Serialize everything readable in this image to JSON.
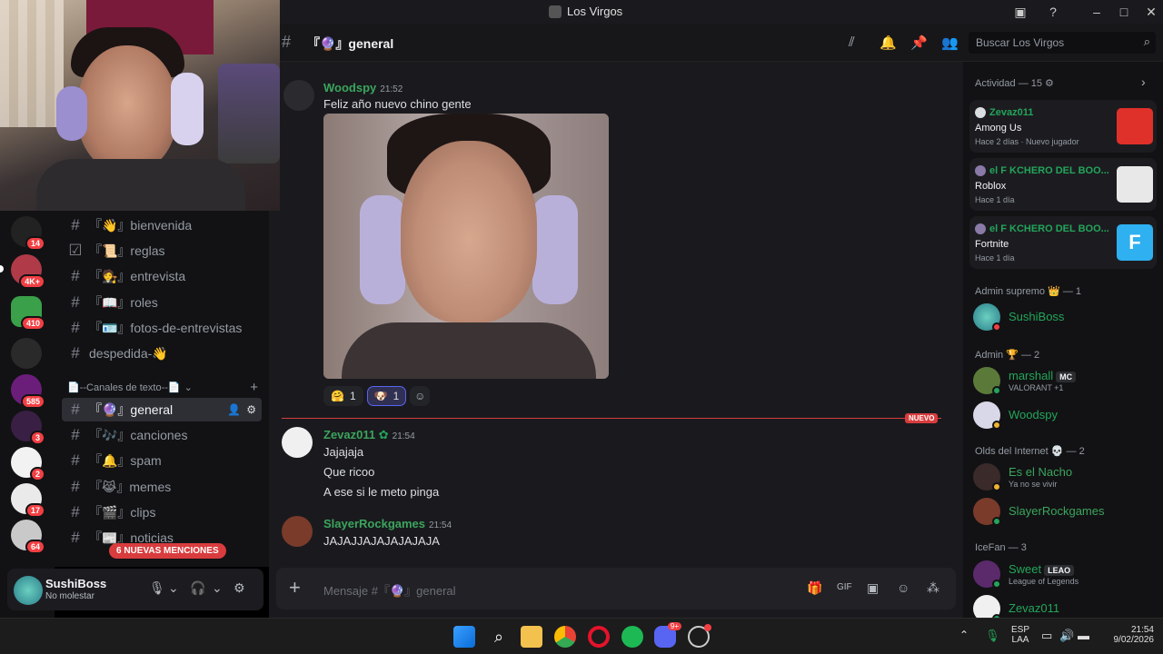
{
  "window": {
    "title": "Los Virgos"
  },
  "server_badges": [
    "14",
    "4K+",
    "410",
    "585",
    "3",
    "2",
    "17",
    "64"
  ],
  "channels": {
    "top": [
      {
        "label": "『👋』bienvenida"
      },
      {
        "label": "『📜』reglas"
      },
      {
        "label": "『🧑‍⚖️』entrevista"
      },
      {
        "label": "『📖』roles"
      },
      {
        "label": "『🪪』fotos-de-entrevistas"
      },
      {
        "label": "despedida-👋"
      }
    ],
    "category": "📄--Canales de texto--📄",
    "list": [
      {
        "label": "『🔮』general"
      },
      {
        "label": "『🎶』canciones"
      },
      {
        "label": "『🔔』spam"
      },
      {
        "label": "『😹』memes"
      },
      {
        "label": "『🎬』clips"
      },
      {
        "label": "『📰』noticias"
      }
    ],
    "mentions_pill": "6 NUEVAS MENCIONES"
  },
  "user": {
    "name": "SushiBoss",
    "status": "No molestar"
  },
  "chat": {
    "channel_name": "『🔮』general",
    "search_placeholder": "Buscar Los Virgos",
    "composer_placeholder": "Mensaje #『🔮』general",
    "new_label": "NUEVO",
    "messages": [
      {
        "author": "Woodspy",
        "time": "21:52",
        "lines": [
          "Feliz año nuevo chino gente"
        ],
        "color": "#3ba55d"
      },
      {
        "author": "Zevaz011",
        "time": "21:54",
        "lines": [
          "Jajajaja",
          "Que ricoo",
          "A ese si le meto pinga"
        ],
        "color": "#3ba55d"
      },
      {
        "author": "SlayerRockgames",
        "time": "21:54",
        "lines": [
          "JAJAJJAJAJAJAJAJA"
        ],
        "color": "#3ba55d"
      }
    ],
    "reactions": [
      {
        "emoji": "🤗",
        "count": "1"
      },
      {
        "emoji": "🐶",
        "count": "1"
      }
    ]
  },
  "activity": {
    "title": "Actividad — 15",
    "cards": [
      {
        "who": "Zevaz011",
        "game": "Among Us",
        "meta": "Hace 2 días · Nuevo jugador"
      },
      {
        "who": "el F KCHERO DEL BOO...",
        "game": "Roblox",
        "meta": "Hace 1 día"
      },
      {
        "who": "el F KCHERO DEL BOO...",
        "game": "Fortnite",
        "meta": "Hace 1 día"
      }
    ]
  },
  "members": {
    "groups": [
      {
        "title": "Admin supremo 👑 — 1"
      },
      {
        "title": "Admin 🏆 — 2"
      },
      {
        "title": "Olds del Internet 💀 — 2"
      },
      {
        "title": "IceFan — 3"
      }
    ],
    "people": [
      {
        "name": "SushiBoss",
        "sub": ""
      },
      {
        "name": "marshall",
        "tag": "MC",
        "sub": "VALORANT +1"
      },
      {
        "name": "Woodspy",
        "sub": ""
      },
      {
        "name": "Es el Nacho",
        "sub": "Ya no se vivir"
      },
      {
        "name": "SlayerRockgames",
        "sub": ""
      },
      {
        "name": "Sweet",
        "tag": "LEAO",
        "sub": "League of Legends"
      },
      {
        "name": "Zevaz011",
        "sub": ""
      }
    ]
  },
  "taskbar": {
    "lang_top": "ESP",
    "lang_bottom": "LAA",
    "time": "21:54",
    "date": "9/02/2026",
    "discord_badge": "9+"
  },
  "colors": {
    "accent": "#5865f2",
    "danger": "#d83c3e",
    "online": "#23a55a"
  }
}
